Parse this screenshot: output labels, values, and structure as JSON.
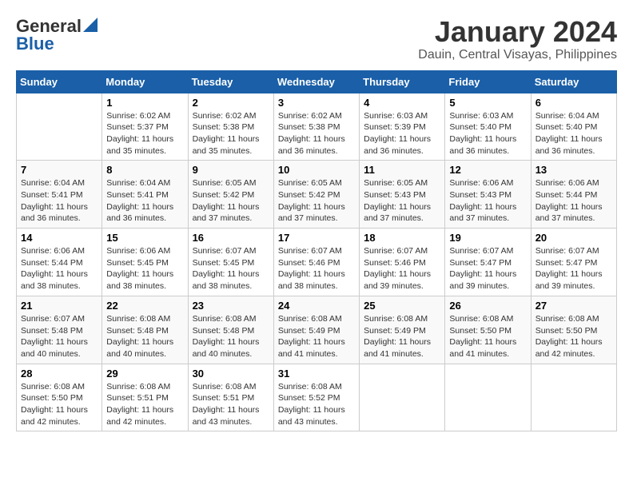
{
  "logo": {
    "text1": "General",
    "text2": "Blue"
  },
  "title": "January 2024",
  "subtitle": "Dauin, Central Visayas, Philippines",
  "headers": [
    "Sunday",
    "Monday",
    "Tuesday",
    "Wednesday",
    "Thursday",
    "Friday",
    "Saturday"
  ],
  "weeks": [
    [
      {
        "day": "",
        "sunrise": "",
        "sunset": "",
        "daylight": ""
      },
      {
        "day": "1",
        "sunrise": "Sunrise: 6:02 AM",
        "sunset": "Sunset: 5:37 PM",
        "daylight": "Daylight: 11 hours and 35 minutes."
      },
      {
        "day": "2",
        "sunrise": "Sunrise: 6:02 AM",
        "sunset": "Sunset: 5:38 PM",
        "daylight": "Daylight: 11 hours and 35 minutes."
      },
      {
        "day": "3",
        "sunrise": "Sunrise: 6:02 AM",
        "sunset": "Sunset: 5:38 PM",
        "daylight": "Daylight: 11 hours and 36 minutes."
      },
      {
        "day": "4",
        "sunrise": "Sunrise: 6:03 AM",
        "sunset": "Sunset: 5:39 PM",
        "daylight": "Daylight: 11 hours and 36 minutes."
      },
      {
        "day": "5",
        "sunrise": "Sunrise: 6:03 AM",
        "sunset": "Sunset: 5:40 PM",
        "daylight": "Daylight: 11 hours and 36 minutes."
      },
      {
        "day": "6",
        "sunrise": "Sunrise: 6:04 AM",
        "sunset": "Sunset: 5:40 PM",
        "daylight": "Daylight: 11 hours and 36 minutes."
      }
    ],
    [
      {
        "day": "7",
        "sunrise": "Sunrise: 6:04 AM",
        "sunset": "Sunset: 5:41 PM",
        "daylight": "Daylight: 11 hours and 36 minutes."
      },
      {
        "day": "8",
        "sunrise": "Sunrise: 6:04 AM",
        "sunset": "Sunset: 5:41 PM",
        "daylight": "Daylight: 11 hours and 36 minutes."
      },
      {
        "day": "9",
        "sunrise": "Sunrise: 6:05 AM",
        "sunset": "Sunset: 5:42 PM",
        "daylight": "Daylight: 11 hours and 37 minutes."
      },
      {
        "day": "10",
        "sunrise": "Sunrise: 6:05 AM",
        "sunset": "Sunset: 5:42 PM",
        "daylight": "Daylight: 11 hours and 37 minutes."
      },
      {
        "day": "11",
        "sunrise": "Sunrise: 6:05 AM",
        "sunset": "Sunset: 5:43 PM",
        "daylight": "Daylight: 11 hours and 37 minutes."
      },
      {
        "day": "12",
        "sunrise": "Sunrise: 6:06 AM",
        "sunset": "Sunset: 5:43 PM",
        "daylight": "Daylight: 11 hours and 37 minutes."
      },
      {
        "day": "13",
        "sunrise": "Sunrise: 6:06 AM",
        "sunset": "Sunset: 5:44 PM",
        "daylight": "Daylight: 11 hours and 37 minutes."
      }
    ],
    [
      {
        "day": "14",
        "sunrise": "Sunrise: 6:06 AM",
        "sunset": "Sunset: 5:44 PM",
        "daylight": "Daylight: 11 hours and 38 minutes."
      },
      {
        "day": "15",
        "sunrise": "Sunrise: 6:06 AM",
        "sunset": "Sunset: 5:45 PM",
        "daylight": "Daylight: 11 hours and 38 minutes."
      },
      {
        "day": "16",
        "sunrise": "Sunrise: 6:07 AM",
        "sunset": "Sunset: 5:45 PM",
        "daylight": "Daylight: 11 hours and 38 minutes."
      },
      {
        "day": "17",
        "sunrise": "Sunrise: 6:07 AM",
        "sunset": "Sunset: 5:46 PM",
        "daylight": "Daylight: 11 hours and 38 minutes."
      },
      {
        "day": "18",
        "sunrise": "Sunrise: 6:07 AM",
        "sunset": "Sunset: 5:46 PM",
        "daylight": "Daylight: 11 hours and 39 minutes."
      },
      {
        "day": "19",
        "sunrise": "Sunrise: 6:07 AM",
        "sunset": "Sunset: 5:47 PM",
        "daylight": "Daylight: 11 hours and 39 minutes."
      },
      {
        "day": "20",
        "sunrise": "Sunrise: 6:07 AM",
        "sunset": "Sunset: 5:47 PM",
        "daylight": "Daylight: 11 hours and 39 minutes."
      }
    ],
    [
      {
        "day": "21",
        "sunrise": "Sunrise: 6:07 AM",
        "sunset": "Sunset: 5:48 PM",
        "daylight": "Daylight: 11 hours and 40 minutes."
      },
      {
        "day": "22",
        "sunrise": "Sunrise: 6:08 AM",
        "sunset": "Sunset: 5:48 PM",
        "daylight": "Daylight: 11 hours and 40 minutes."
      },
      {
        "day": "23",
        "sunrise": "Sunrise: 6:08 AM",
        "sunset": "Sunset: 5:48 PM",
        "daylight": "Daylight: 11 hours and 40 minutes."
      },
      {
        "day": "24",
        "sunrise": "Sunrise: 6:08 AM",
        "sunset": "Sunset: 5:49 PM",
        "daylight": "Daylight: 11 hours and 41 minutes."
      },
      {
        "day": "25",
        "sunrise": "Sunrise: 6:08 AM",
        "sunset": "Sunset: 5:49 PM",
        "daylight": "Daylight: 11 hours and 41 minutes."
      },
      {
        "day": "26",
        "sunrise": "Sunrise: 6:08 AM",
        "sunset": "Sunset: 5:50 PM",
        "daylight": "Daylight: 11 hours and 41 minutes."
      },
      {
        "day": "27",
        "sunrise": "Sunrise: 6:08 AM",
        "sunset": "Sunset: 5:50 PM",
        "daylight": "Daylight: 11 hours and 42 minutes."
      }
    ],
    [
      {
        "day": "28",
        "sunrise": "Sunrise: 6:08 AM",
        "sunset": "Sunset: 5:50 PM",
        "daylight": "Daylight: 11 hours and 42 minutes."
      },
      {
        "day": "29",
        "sunrise": "Sunrise: 6:08 AM",
        "sunset": "Sunset: 5:51 PM",
        "daylight": "Daylight: 11 hours and 42 minutes."
      },
      {
        "day": "30",
        "sunrise": "Sunrise: 6:08 AM",
        "sunset": "Sunset: 5:51 PM",
        "daylight": "Daylight: 11 hours and 43 minutes."
      },
      {
        "day": "31",
        "sunrise": "Sunrise: 6:08 AM",
        "sunset": "Sunset: 5:52 PM",
        "daylight": "Daylight: 11 hours and 43 minutes."
      },
      {
        "day": "",
        "sunrise": "",
        "sunset": "",
        "daylight": ""
      },
      {
        "day": "",
        "sunrise": "",
        "sunset": "",
        "daylight": ""
      },
      {
        "day": "",
        "sunrise": "",
        "sunset": "",
        "daylight": ""
      }
    ]
  ]
}
